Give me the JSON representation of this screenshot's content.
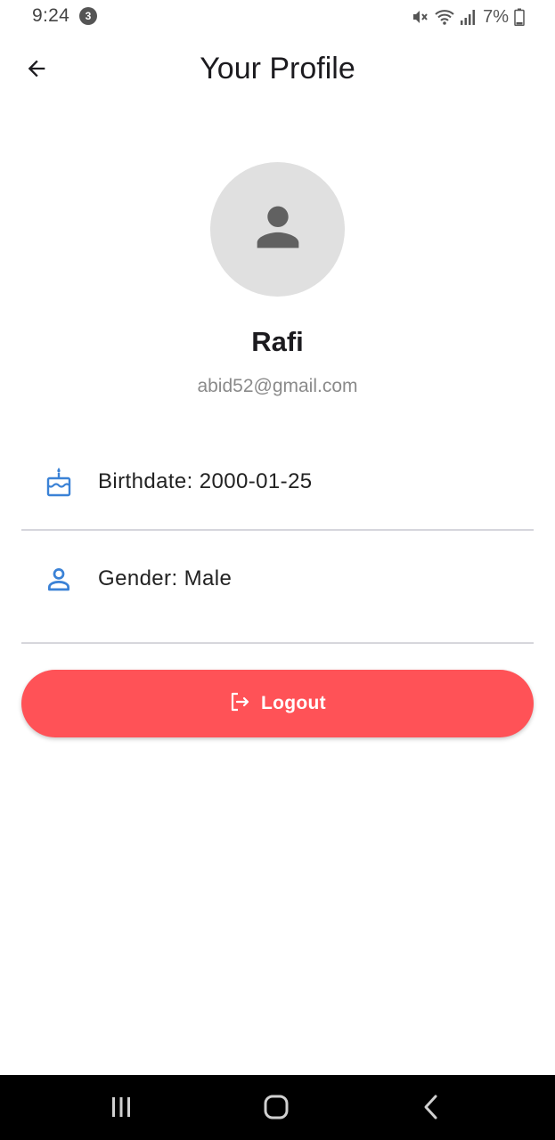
{
  "status_bar": {
    "time": "9:24",
    "notification_count": "3",
    "battery": "7%",
    "icons": [
      "mute-icon",
      "wifi-icon",
      "signal-icon",
      "battery-icon"
    ]
  },
  "header": {
    "title": "Your Profile",
    "back_icon": "arrow-back-icon"
  },
  "profile": {
    "avatar_icon": "person-icon",
    "name": "Rafi",
    "email": "abid52@gmail.com"
  },
  "info": [
    {
      "icon": "cake-icon",
      "label": "Birthdate: 2000-01-25"
    },
    {
      "icon": "person-outline-icon",
      "label": "Gender: Male"
    }
  ],
  "logout": {
    "icon": "logout-icon",
    "label": "Logout"
  },
  "colors": {
    "accent_blue": "#3b82d6",
    "logout_red": "#ff5257",
    "avatar_bg": "#e0e0e0",
    "avatar_icon": "#616161"
  },
  "nav_bar": {
    "buttons": [
      "recent-apps-icon",
      "home-icon",
      "back-icon"
    ]
  }
}
